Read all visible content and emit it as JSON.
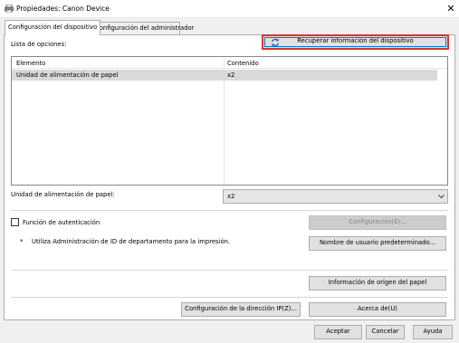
{
  "window": {
    "title": "Propiedades: Canon Device",
    "close_glyph": "✕"
  },
  "tabs": [
    {
      "label": "Configuración del dispositivo",
      "active": true
    },
    {
      "label": "Configuración del administrador",
      "active": false
    }
  ],
  "options": {
    "label": "Lista de opciones:",
    "refresh_button": "Recuperar información del dispositivo",
    "columns": [
      "Elemento",
      "Contenido"
    ],
    "rows": [
      {
        "item": "Unidad de alimentación de papel",
        "value": "x2"
      }
    ]
  },
  "paper_unit": {
    "label": "Unidad de alimentación de papel:",
    "selected": "x2"
  },
  "auth": {
    "checkbox_label": "Función de autenticación",
    "checked": false,
    "config_button": "Configuración(E)...",
    "note_marker": "*",
    "note": "Utiliza Administración de ID de departamento para la impresión.",
    "default_user_button": "Nombre de usuario predeterminado..."
  },
  "paper_source_button": "Información de origen del papel",
  "ip_button": "Configuración de la dirección IP(Z)...",
  "about_button": "Acerca de(U)",
  "footer": {
    "ok": "Aceptar",
    "cancel": "Cancelar",
    "help": "Ayuda"
  },
  "colors": {
    "selection": "#d9d9d9",
    "focus_border": "#d7352c",
    "refresh_icon": "#1f5fbf"
  },
  "icons": {
    "window": "printer-icon",
    "refresh": "refresh-icon",
    "dropdown": "chevron-down-icon"
  }
}
